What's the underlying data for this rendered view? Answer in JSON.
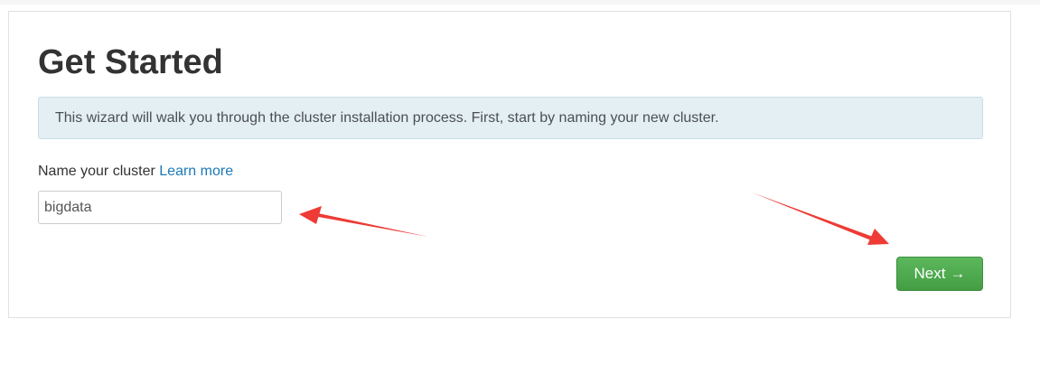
{
  "wizard": {
    "title": "Get Started",
    "info_text": "This wizard will walk you through the cluster installation process. First, start by naming your new cluster.",
    "cluster_label": "Name your cluster",
    "learn_more_label": "Learn more",
    "cluster_name_value": "bigdata",
    "next_label": "Next",
    "next_arrow": "→"
  },
  "annotations": {
    "arrow_color": "#ee3b35",
    "arrow_count": 2
  }
}
